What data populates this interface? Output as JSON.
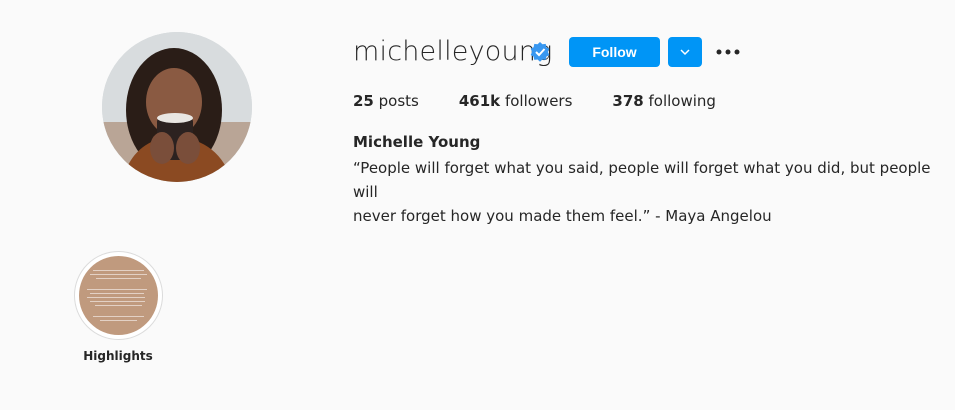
{
  "profile": {
    "username": "michelleyoung",
    "verified": true,
    "follow_label": "Follow",
    "stats": {
      "posts_count": "25",
      "posts_label": "posts",
      "followers_count": "461k",
      "followers_label": "followers",
      "following_count": "378",
      "following_label": "following"
    },
    "full_name": "Michelle Young",
    "bio_line1": "“People will forget what you said, people will forget what you did, but people will",
    "bio_line2": "never forget how you made them feel.” - Maya Angelou"
  },
  "highlights": [
    {
      "label": "Highlights"
    }
  ],
  "colors": {
    "accent": "#0095f6",
    "verified": "#3897f0",
    "highlight_bg": "#c09a7e"
  },
  "icons": {
    "verified": "verified-badge-icon",
    "dropdown": "chevron-down-icon",
    "more": "more-options-icon"
  }
}
